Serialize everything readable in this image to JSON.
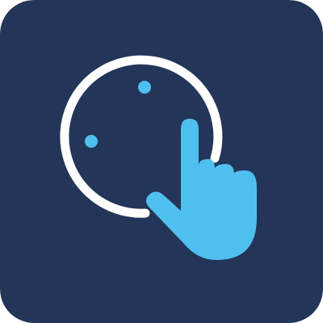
{
  "icon": {
    "name": "tap-timer-icon",
    "colors": {
      "background": "#233558",
      "ring": "#ffffff",
      "accent": "#4fbfef"
    }
  }
}
